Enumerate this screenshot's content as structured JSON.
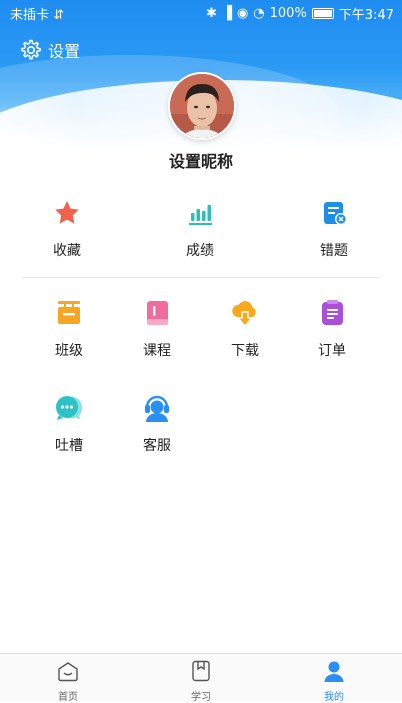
{
  "status": {
    "carrier": "未插卡",
    "battery": "100%",
    "time": "下午3:47"
  },
  "header": {
    "settings_label": "设置",
    "nickname": "设置昵称"
  },
  "grid1": [
    {
      "label": "收藏",
      "icon": "star-icon"
    },
    {
      "label": "成绩",
      "icon": "bar-chart-icon"
    },
    {
      "label": "错题",
      "icon": "wrong-question-icon"
    }
  ],
  "grid2": [
    {
      "label": "班级",
      "icon": "class-sign-icon"
    },
    {
      "label": "课程",
      "icon": "book-icon"
    },
    {
      "label": "下载",
      "icon": "cloud-download-icon"
    },
    {
      "label": "订单",
      "icon": "order-icon"
    },
    {
      "label": "吐槽",
      "icon": "chat-icon"
    },
    {
      "label": "客服",
      "icon": "customer-service-icon"
    }
  ],
  "tabs": [
    {
      "label": "首页"
    },
    {
      "label": "学习"
    },
    {
      "label": "我的"
    }
  ],
  "colors": {
    "primary": "#2a8ff0",
    "star": "#f2614b",
    "chart": "#2bbfb8",
    "wrong": "#1d8fe8",
    "class": "#f5a623",
    "book": "#f06c9a",
    "download": "#f7a81b",
    "order": "#a850d8",
    "chat": "#2bc3c6",
    "service": "#2a8ff0"
  }
}
